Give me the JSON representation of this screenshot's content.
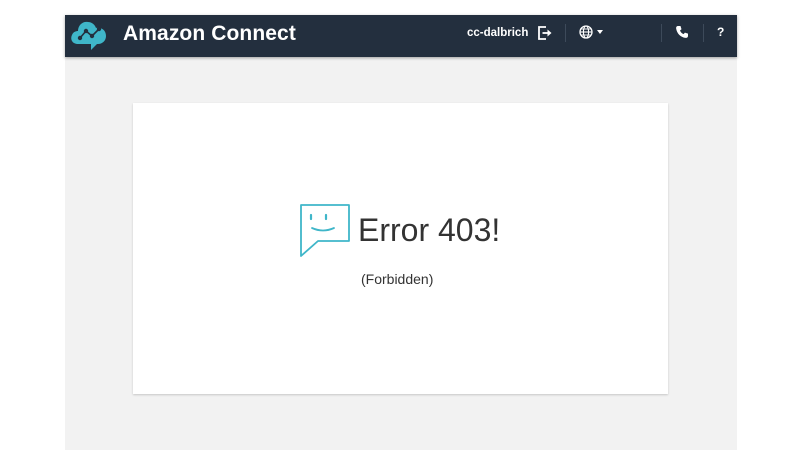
{
  "header": {
    "app_title": "Amazon Connect",
    "username": "cc-dalbrich",
    "help_label": "?",
    "icons": {
      "logo": "cloud-network-logo",
      "logout": "logout-icon",
      "language": "globe-icon",
      "language_menu": "chevron-down-icon",
      "phone": "phone-icon"
    },
    "background_color": "#232f3e"
  },
  "error": {
    "title": "Error 403!",
    "subtitle": "(Forbidden)",
    "icon": "chat-bubble-face-icon"
  },
  "colors": {
    "logo_accent": "#3fb6c9",
    "page_background": "#f2f2f2",
    "card_background": "#ffffff",
    "text": "#333333"
  }
}
